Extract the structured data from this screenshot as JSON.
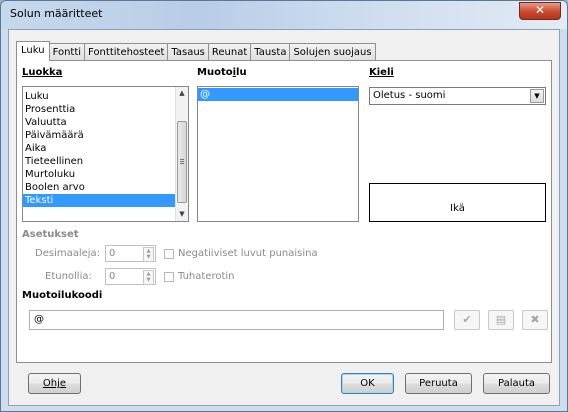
{
  "window": {
    "title": "Solun määritteet",
    "close_glyph": "✕"
  },
  "tabs": [
    {
      "label": "Luku",
      "active": true
    },
    {
      "label": "Fontti",
      "active": false
    },
    {
      "label": "Fonttitehosteet",
      "active": false
    },
    {
      "label": "Tasaus",
      "active": false
    },
    {
      "label": "Reunat",
      "active": false
    },
    {
      "label": "Tausta",
      "active": false
    },
    {
      "label": "Solujen suojaus",
      "active": false
    }
  ],
  "category": {
    "heading": "Luokka",
    "items": [
      "Luku",
      "Prosenttia",
      "Valuutta",
      "Päivämäärä",
      "Aika",
      "Tieteellinen",
      "Murtoluku",
      "Boolen arvo",
      "Teksti"
    ],
    "selected_index": 8
  },
  "format": {
    "heading_before": "Muoto",
    "heading_ul": "i",
    "heading_after": "lu",
    "items": [
      "@"
    ],
    "selected_index": 0
  },
  "language": {
    "heading": "Kieli",
    "value": "Oletus - suomi"
  },
  "preview": {
    "text": "Ikä"
  },
  "options": {
    "heading": "Asetukset",
    "decimals_label": "Desimaaleja:",
    "decimals_value": "0",
    "leading_label": "Etunollia:",
    "leading_value": "0",
    "negative_red_label": "Negatiiviset luvut punaisina",
    "thousands_label": "Tuhaterotin"
  },
  "format_code": {
    "heading": "Muotoilukoodi",
    "value": "@"
  },
  "buttons": {
    "help": "Ohje",
    "ok": "OK",
    "cancel": "Peruuta",
    "reset": "Palauta"
  }
}
